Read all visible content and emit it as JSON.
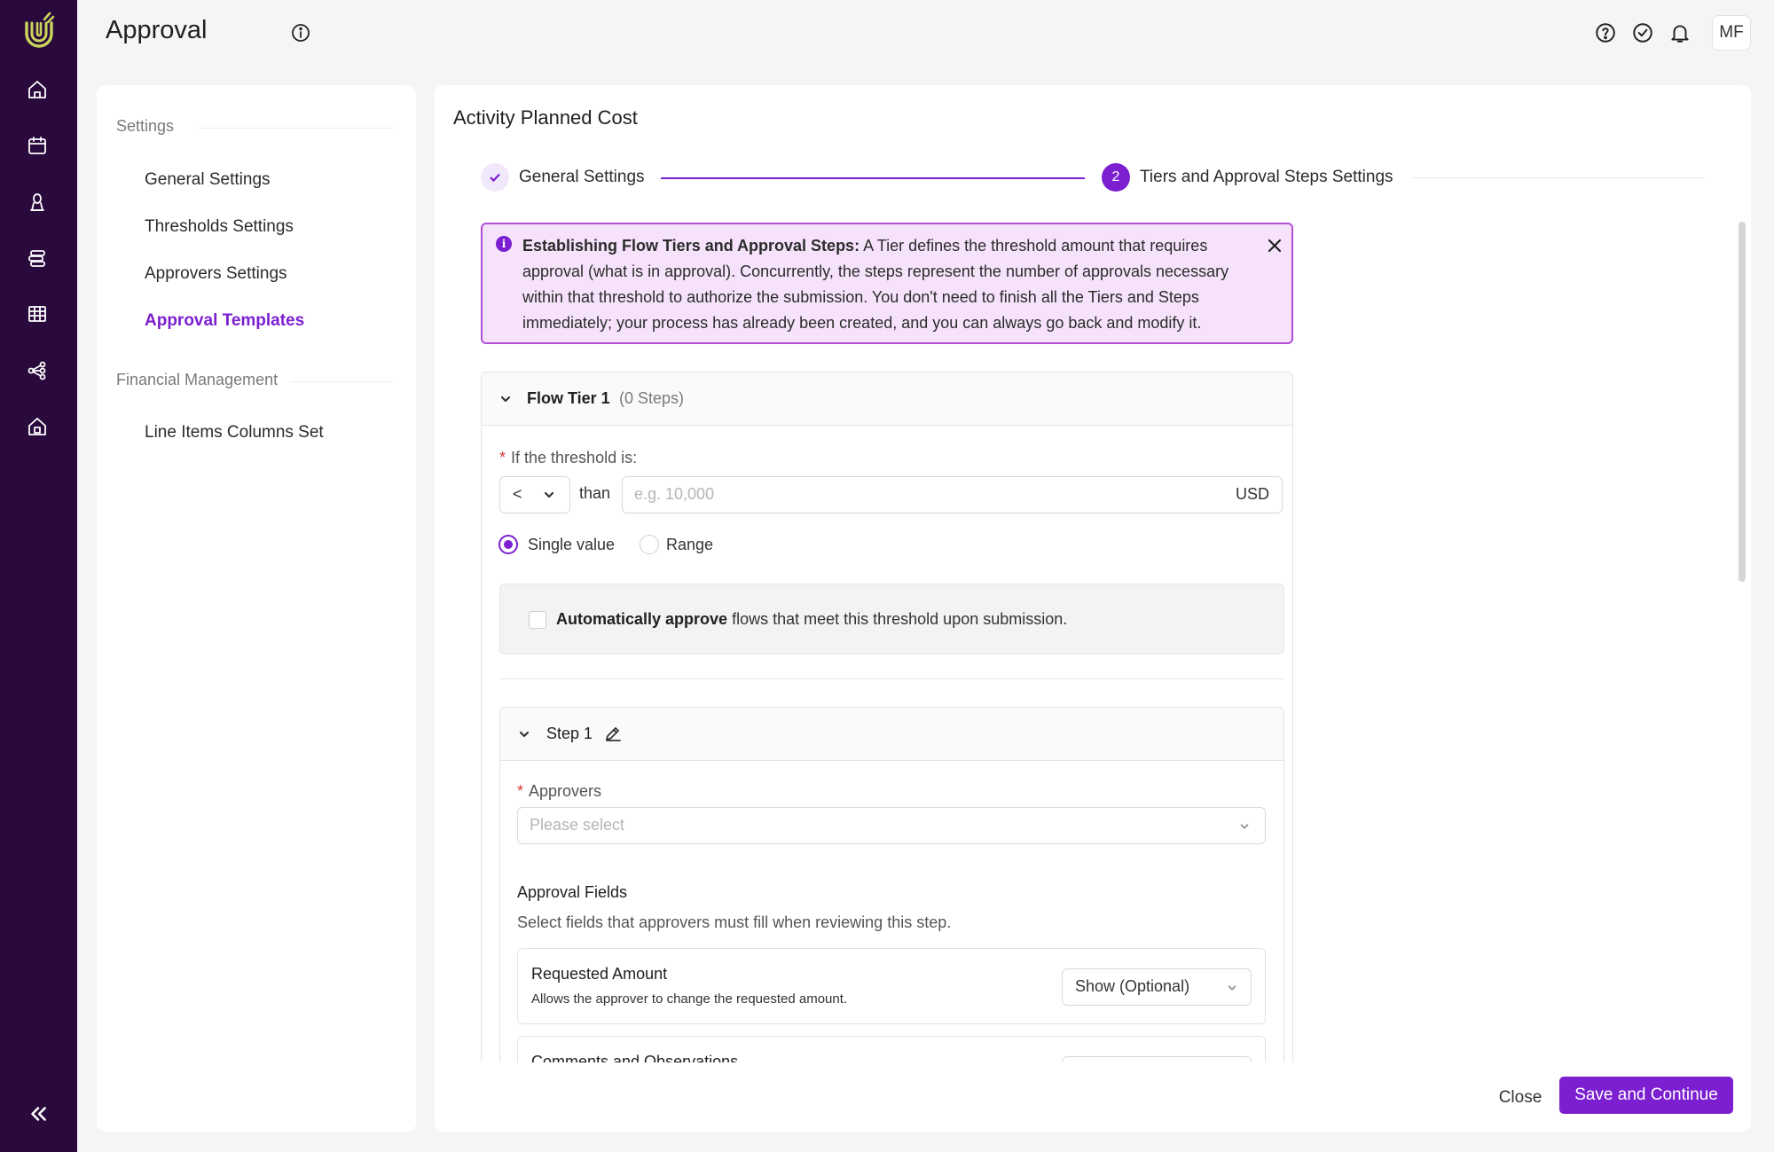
{
  "header": {
    "title": "Approval",
    "avatar_initials": "MF"
  },
  "rail": {
    "icons": [
      "home-icon",
      "calendar-icon",
      "award-icon",
      "stack-icon",
      "table-icon",
      "share-icon",
      "building-icon"
    ],
    "collapse_icon": "double-chevron-left-icon"
  },
  "settings_panel": {
    "groups": [
      {
        "title": "Settings",
        "items": [
          "General Settings",
          "Thresholds Settings",
          "Approvers Settings",
          "Approval Templates"
        ]
      },
      {
        "title": "Financial Management",
        "items": [
          "Line Items Columns Set"
        ]
      }
    ],
    "active_item": "Approval Templates"
  },
  "main": {
    "title": "Activity Planned Cost",
    "stepper": {
      "step1_label": "General Settings",
      "step2_number": "2",
      "step2_label": "Tiers and Approval Steps Settings"
    },
    "banner": {
      "bold": "Establishing Flow Tiers and Approval Steps:",
      "text": " A Tier defines the threshold amount that requires approval (what is in approval). Concurrently, the steps represent the number of approvals necessary within that threshold to authorize the submission. You don't need to finish all the Tiers and Steps immediately; your process has already been created, and you can always go back and modify it."
    },
    "tier": {
      "title": "Flow Tier 1",
      "count": "(0 Steps)",
      "required_mark": "*",
      "threshold_label": "If the threshold is:",
      "operator": "<",
      "than": "than",
      "amount_placeholder": "e.g. 10,000",
      "currency": "USD",
      "radio_single": "Single value",
      "radio_range": "Range",
      "auto_bold": "Automatically approve",
      "auto_text": " flows that meet this threshold upon submission."
    },
    "step": {
      "name": "Step 1",
      "approvers_label": "Approvers",
      "approvers_placeholder": "Please select",
      "approval_fields_title": "Approval Fields",
      "approval_fields_desc": "Select fields that approvers must fill when reviewing this step.",
      "fields": [
        {
          "name": "Requested Amount",
          "desc": "Allows the approver to change the requested amount.",
          "value": "Show (Optional)"
        },
        {
          "name": "Comments and Observations",
          "desc": "",
          "value": ""
        }
      ]
    }
  },
  "footer": {
    "close_label": "Close",
    "save_label": "Save and Continue"
  },
  "colors": {
    "accent": "#7b1fd1",
    "rail_bg": "#2a0a3d",
    "banner_bg": "#f6e3fb",
    "banner_border": "#b04fd6",
    "logo_gold": "#c9d65a"
  }
}
